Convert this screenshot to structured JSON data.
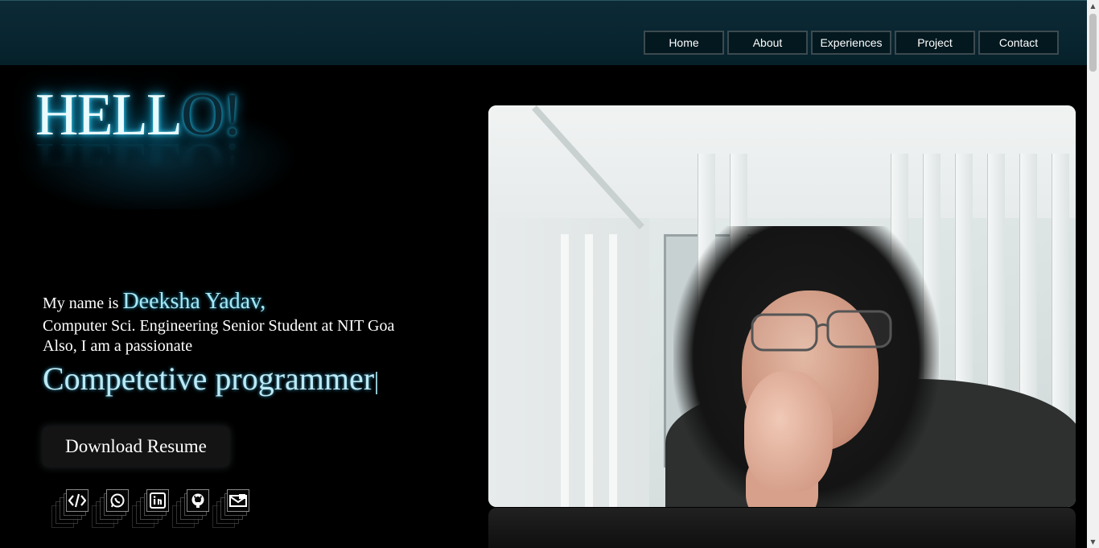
{
  "nav": {
    "items": [
      "Home",
      "About",
      "Experiences",
      "Project",
      "Contact"
    ]
  },
  "hero": {
    "hello_main": "HELL",
    "hello_dim": "O!",
    "hello_reflection": "HELLO!",
    "intro_prefix": "My name is ",
    "name": "Deeksha Yadav,",
    "line2": "Computer Sci. Engineering Senior Student at NIT Goa",
    "line3": "Also, I am a passionate",
    "typed_text": "Competetive programmer",
    "resume_button": "Download Resume"
  },
  "socials": [
    {
      "icon": "code-icon"
    },
    {
      "icon": "whatsapp-icon"
    },
    {
      "icon": "linkedin-icon"
    },
    {
      "icon": "github-icon"
    },
    {
      "icon": "mail-icon"
    }
  ],
  "colors": {
    "header_bg": "#082530",
    "accent_glow": "#1fb6e6",
    "name_color": "#a7e8f7",
    "page_bg": "#000000"
  }
}
